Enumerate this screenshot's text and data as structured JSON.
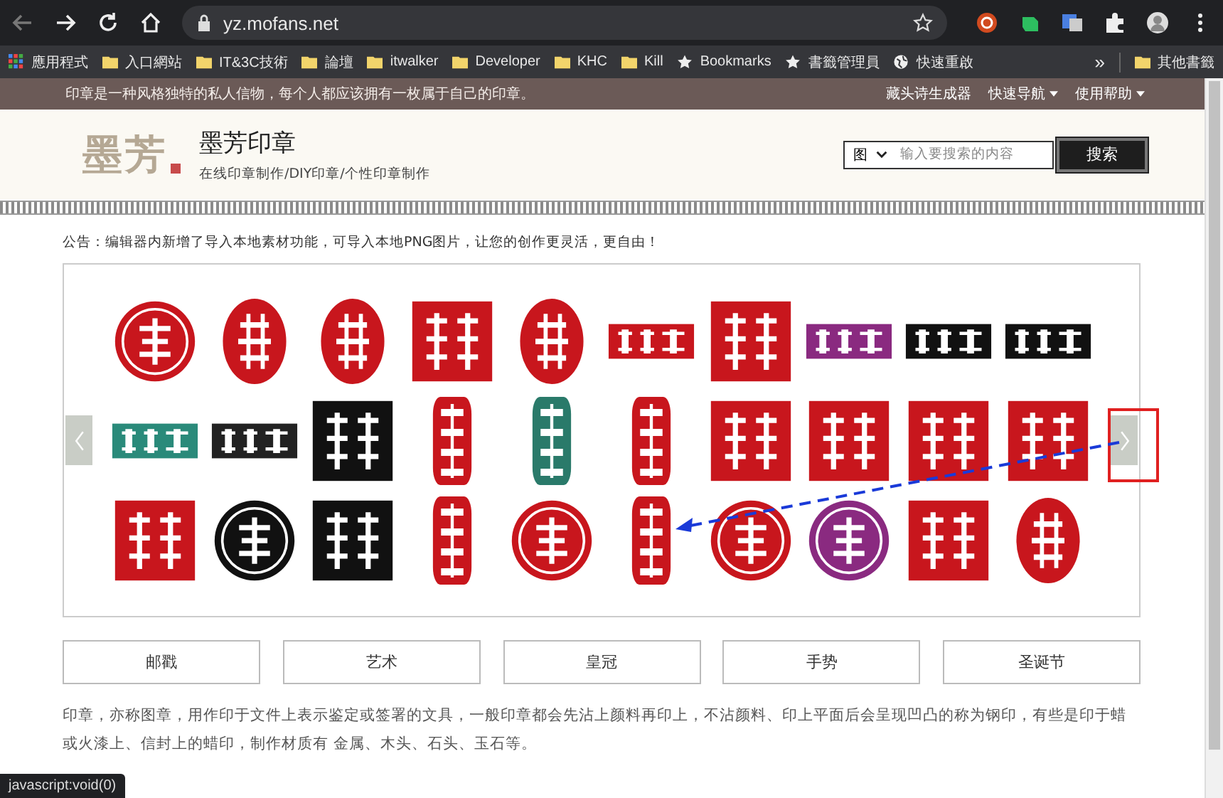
{
  "browser": {
    "url": "yz.mofans.net",
    "bookmarks": [
      {
        "label": "應用程式",
        "kind": "apps"
      },
      {
        "label": "入口網站",
        "kind": "folder"
      },
      {
        "label": "IT&3C技術",
        "kind": "folder"
      },
      {
        "label": "論壇",
        "kind": "folder"
      },
      {
        "label": "itwalker",
        "kind": "folder"
      },
      {
        "label": "Developer",
        "kind": "folder"
      },
      {
        "label": "KHC",
        "kind": "folder"
      },
      {
        "label": "Kill",
        "kind": "folder"
      },
      {
        "label": "Bookmarks",
        "kind": "star"
      },
      {
        "label": "書籤管理員",
        "kind": "star"
      },
      {
        "label": "快速重啟",
        "kind": "globe"
      }
    ],
    "overflow": "»",
    "other_bookmarks": "其他書籤"
  },
  "topbar": {
    "slogan": "印章是一种风格独特的私人信物，每个人都应该拥有一枚属于自己的印章。",
    "links": [
      {
        "label": "藏头诗生成器",
        "dropdown": false
      },
      {
        "label": "快速导航",
        "dropdown": true
      },
      {
        "label": "使用帮助",
        "dropdown": true
      }
    ]
  },
  "header": {
    "logo_text": "墨芳",
    "site_name": "墨芳印章",
    "tagline": "在线印章制作/DIY印章/个性印章制作",
    "search": {
      "category": "图",
      "placeholder": "输入要搜索的内容",
      "button": "搜索"
    }
  },
  "notice": "公告：编辑器内新增了导入本地素材功能，可导入本地PNG图片，让您的创作更灵活，更自由！",
  "carousel": {
    "stamps": [
      {
        "kind": "circle",
        "color": "#c8161d"
      },
      {
        "kind": "oval",
        "color": "#c8161d"
      },
      {
        "kind": "oval",
        "color": "#c8161d"
      },
      {
        "kind": "square",
        "color": "#c8161d"
      },
      {
        "kind": "oval",
        "color": "#c8161d"
      },
      {
        "kind": "banner",
        "color": "#c8161d"
      },
      {
        "kind": "square",
        "color": "#c8161d"
      },
      {
        "kind": "banner",
        "color": "#8a2a80"
      },
      {
        "kind": "banner",
        "color": "#111111"
      },
      {
        "kind": "banner",
        "color": "#111111"
      },
      {
        "kind": "banner",
        "color": "#2a8a7a"
      },
      {
        "kind": "banner",
        "color": "#222222"
      },
      {
        "kind": "square",
        "color": "#111111"
      },
      {
        "kind": "rect",
        "color": "#c8161d"
      },
      {
        "kind": "rect",
        "color": "#2a7a6a"
      },
      {
        "kind": "rect",
        "color": "#c8161d"
      },
      {
        "kind": "square",
        "color": "#c8161d"
      },
      {
        "kind": "square",
        "color": "#c8161d"
      },
      {
        "kind": "square",
        "color": "#c8161d"
      },
      {
        "kind": "square",
        "color": "#c8161d"
      },
      {
        "kind": "square",
        "color": "#c8161d"
      },
      {
        "kind": "circle",
        "color": "#111111"
      },
      {
        "kind": "square",
        "color": "#111111"
      },
      {
        "kind": "rect",
        "color": "#c8161d"
      },
      {
        "kind": "circle",
        "color": "#c8161d"
      },
      {
        "kind": "rect",
        "color": "#c8161d"
      },
      {
        "kind": "circle",
        "color": "#c8161d"
      },
      {
        "kind": "circle",
        "color": "#8a2a80"
      },
      {
        "kind": "square",
        "color": "#c8161d"
      },
      {
        "kind": "oval",
        "color": "#c8161d"
      }
    ]
  },
  "categories": [
    "邮戳",
    "艺术",
    "皇冠",
    "手势",
    "圣诞节"
  ],
  "description": "印章，亦称图章，用作印于文件上表示鉴定或签署的文具，一般印章都会先沾上颜料再印上，不沾颜料、印上平面后会呈现凹凸的称为钢印，有些是印于蜡或火漆上、信封上的蜡印，制作材质有 金属、木头、石头、玉石等。",
  "status_bar": "javascript:void(0)"
}
